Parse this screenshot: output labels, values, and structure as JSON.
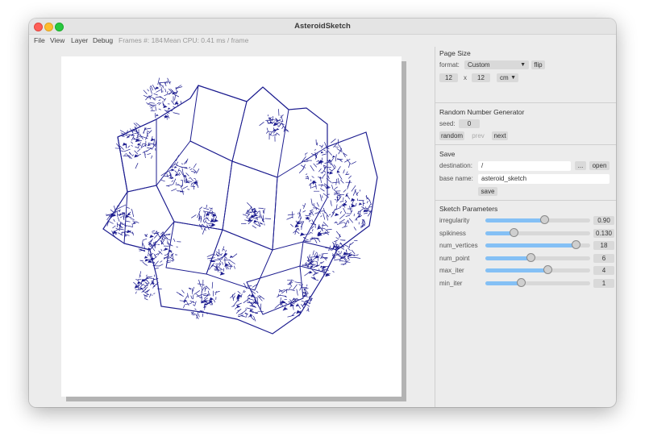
{
  "window": {
    "title": "AsteroidSketch"
  },
  "menu": {
    "file": "File",
    "view": "View",
    "layer": "Layer",
    "debug": "Debug",
    "frames": "Frames #: 184",
    "cpu": "Mean CPU: 0.41 ms / frame"
  },
  "page_size": {
    "title": "Page Size",
    "format_label": "format:",
    "format_value": "Custom",
    "flip": "flip",
    "width": "12",
    "x": "x",
    "height": "12",
    "unit": "cm"
  },
  "rng": {
    "title": "Random Number Generator",
    "seed_label": "seed:",
    "seed": "0",
    "random": "random",
    "prev": "prev",
    "next": "next"
  },
  "save": {
    "title": "Save",
    "destination_label": "destination:",
    "destination": "/",
    "browse": "...",
    "open": "open",
    "base_name_label": "base name:",
    "base_name": "asteroid_sketch",
    "save_button": "save"
  },
  "params": {
    "title": "Sketch Parameters",
    "items": [
      {
        "label": "irregularity",
        "value": "0.90",
        "fill": 0.56
      },
      {
        "label": "spikiness",
        "value": "0.130",
        "fill": 0.27
      },
      {
        "label": "num_vertices",
        "value": "18",
        "fill": 0.86
      },
      {
        "label": "num_point",
        "value": "6",
        "fill": 0.43
      },
      {
        "label": "max_iter",
        "value": "4",
        "fill": 0.59
      },
      {
        "label": "min_iter",
        "value": "1",
        "fill": 0.34
      }
    ]
  },
  "colors": {
    "stroke": "#1c1c8f",
    "slider_fill": "#84c0f5",
    "close": "#fe5f57",
    "minimize": "#febc2e",
    "maximize": "#28c840"
  }
}
